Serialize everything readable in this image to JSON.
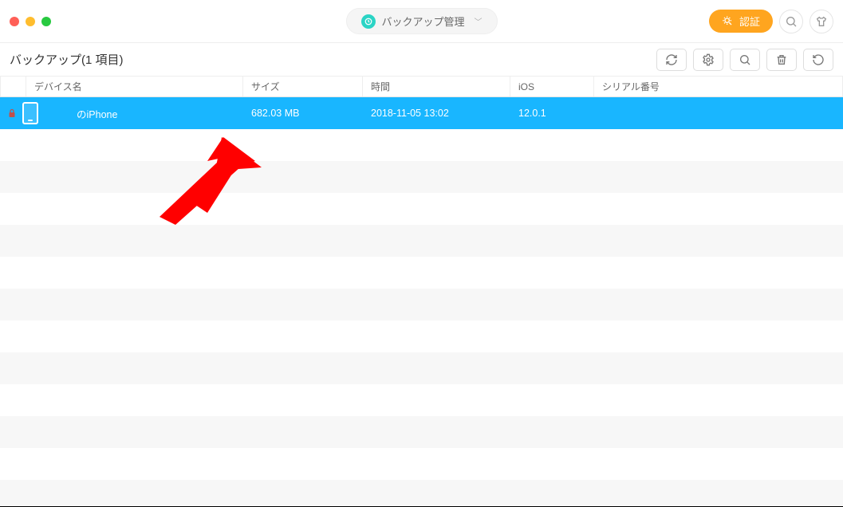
{
  "titlebar": {
    "dropdown_label": "バックアップ管理",
    "auth_label": "認証"
  },
  "subheader": {
    "title": "バックアップ(1 項目)"
  },
  "columns": {
    "device": "デバイス名",
    "size": "サイズ",
    "time": "時間",
    "ios": "iOS",
    "serial": "シリアル番号"
  },
  "rows": [
    {
      "device": "のiPhone",
      "size": "682.03 MB",
      "time": "2018-11-05 13:02",
      "ios": "12.0.1",
      "serial": ""
    }
  ]
}
